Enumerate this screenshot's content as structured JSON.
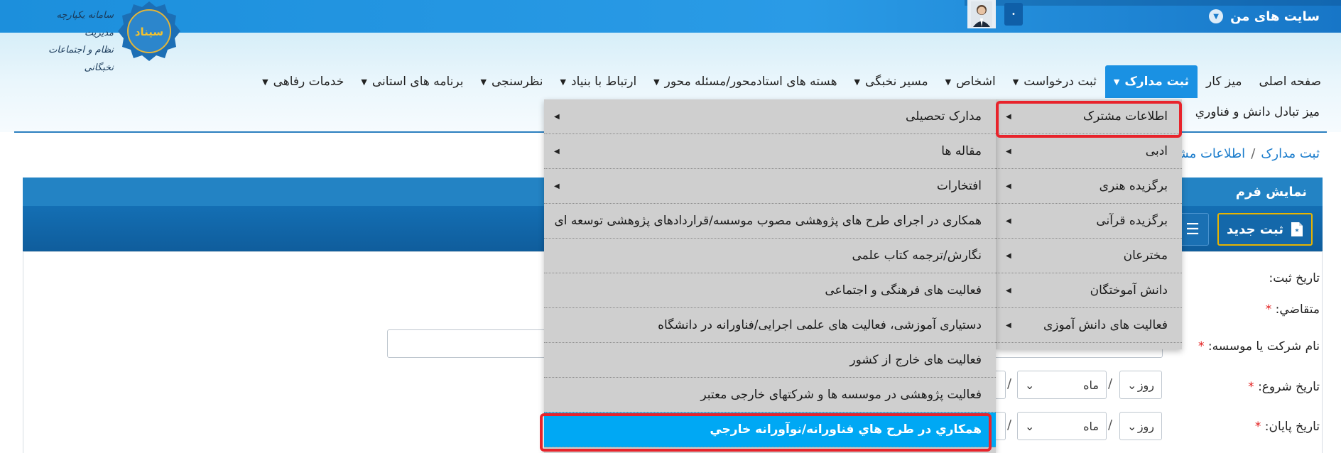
{
  "topbar": {
    "my_sites_label": "سایت های من",
    "dot_button": "•"
  },
  "logo": {
    "line1": "سامانه یکپارچه مدیریت",
    "line2": "نظام و اجتماعات نخبگانی",
    "seal_text": "سیناد"
  },
  "nav": {
    "items": [
      {
        "label": "صفحه اصلی",
        "has_caret": false
      },
      {
        "label": "میز کار",
        "has_caret": false
      },
      {
        "label": "ثبت مدارک",
        "has_caret": true,
        "active": true
      },
      {
        "label": "ثبت درخواست",
        "has_caret": true
      },
      {
        "label": "اشخاص",
        "has_caret": true
      },
      {
        "label": "مسیر نخبگی",
        "has_caret": true
      },
      {
        "label": "هسته های استادمحور/مسئله محور",
        "has_caret": true
      },
      {
        "label": "ارتباط با بنیاد",
        "has_caret": true
      },
      {
        "label": "نظرسنجی",
        "has_caret": true
      },
      {
        "label": "برنامه های استانی",
        "has_caret": true
      },
      {
        "label": "خدمات رفاهی",
        "has_caret": true
      }
    ],
    "row2": "میز تبادل دانش و فناوري"
  },
  "breadcrumb": {
    "item1": "ثبت مدارک",
    "sep": "/",
    "item2": "اطلاعات مشترک"
  },
  "panel": {
    "title": "نمایش فرم",
    "new_button": "ثبت جدید"
  },
  "form": {
    "reg_date": "تاریخ ثبت:",
    "applicant": "متقاضي:",
    "company": "نام شرکت یا موسسه:",
    "start_date": "تاریخ شروع:",
    "end_date": "تاریخ پایان:",
    "required_mark": "*",
    "day": "روز",
    "month": "ماه",
    "slash": "/"
  },
  "submenu1": {
    "items": [
      "اطلاعات مشترک",
      "ادبی",
      "برگزیده هنری",
      "برگزیده قرآنی",
      "مخترعان",
      "دانش آموختگان",
      "فعالیت های دانش آموزی"
    ]
  },
  "submenu2": {
    "items": [
      {
        "label": "مدارک تحصیلی",
        "arrow": true
      },
      {
        "label": "مقاله ها",
        "arrow": true
      },
      {
        "label": "افتخارات",
        "arrow": true
      },
      {
        "label": "همکاری در اجرای طرح های پژوهشی مصوب موسسه/قراردادهای پژوهشی توسعه ای",
        "arrow": false
      },
      {
        "label": "نگارش/ترجمه کتاب علمی",
        "arrow": false
      },
      {
        "label": "فعالیت های فرهنگی و اجتماعی",
        "arrow": false
      },
      {
        "label": "دستیاری آموزشی، فعالیت های علمی اجرایی/فناورانه در دانشگاه",
        "arrow": false
      },
      {
        "label": "فعالیت های خارج از کشور",
        "arrow": false
      },
      {
        "label": "فعالیت پژوهشی در موسسه ها و شرکتهای خارجی معتبر",
        "arrow": false
      },
      {
        "label": "همکاري در طرح هاي فناورانه/نوآورانه خارجي",
        "arrow": false,
        "highlight": true
      }
    ]
  },
  "colors": {
    "topbar": "#1c8fdc",
    "active_nav": "#1a91e3",
    "highlight": "#00a8f4",
    "annotation_red": "#e8232b"
  }
}
